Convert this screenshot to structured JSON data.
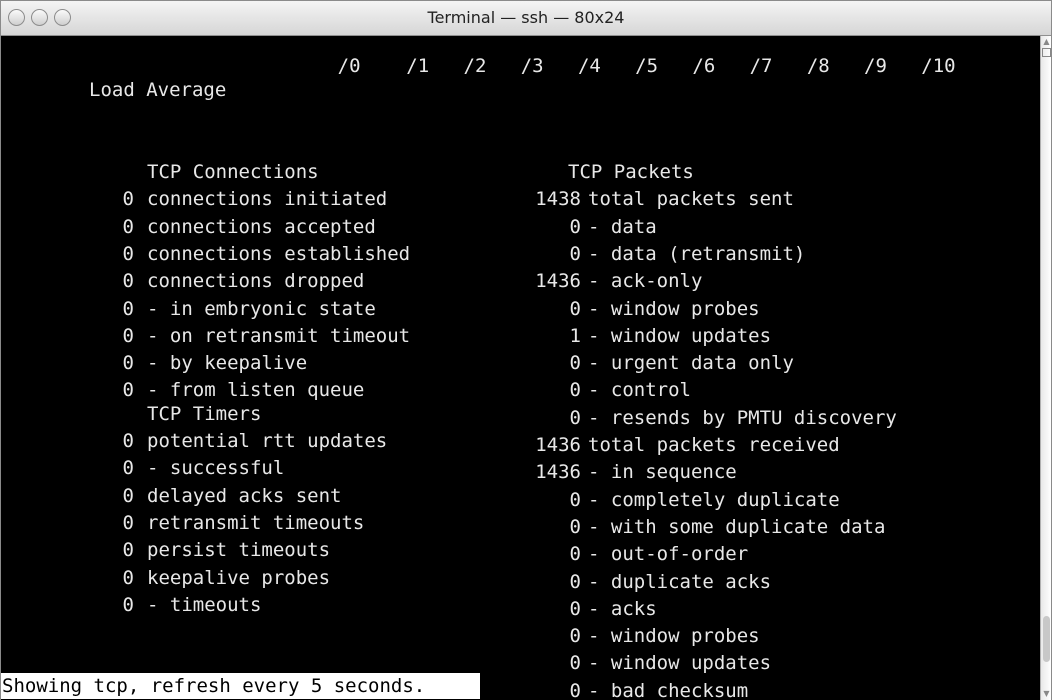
{
  "window": {
    "title": "Terminal — ssh — 80x24"
  },
  "load_average": {
    "label": "Load Average",
    "scale": [
      "/0",
      "/1",
      "/2",
      "/3",
      "/4",
      "/5",
      "/6",
      "/7",
      "/8",
      "/9",
      "/10"
    ]
  },
  "tcp_connections": {
    "heading": "TCP Connections",
    "rows": [
      {
        "value": "0",
        "label": "connections initiated"
      },
      {
        "value": "0",
        "label": "connections accepted"
      },
      {
        "value": "0",
        "label": "connections established"
      },
      {
        "value": "0",
        "label": "connections dropped"
      },
      {
        "value": "0",
        "label": "- in embryonic state"
      },
      {
        "value": "0",
        "label": "- on retransmit timeout"
      },
      {
        "value": "0",
        "label": "- by keepalive"
      },
      {
        "value": "0",
        "label": "- from listen queue"
      }
    ]
  },
  "tcp_timers": {
    "heading": "TCP Timers",
    "rows": [
      {
        "value": "0",
        "label": "potential rtt updates"
      },
      {
        "value": "0",
        "label": "- successful"
      },
      {
        "value": "0",
        "label": "delayed acks sent"
      },
      {
        "value": "0",
        "label": "retransmit timeouts"
      },
      {
        "value": "0",
        "label": "persist timeouts"
      },
      {
        "value": "0",
        "label": "keepalive probes"
      },
      {
        "value": "0",
        "label": "- timeouts"
      }
    ]
  },
  "tcp_packets": {
    "heading": "TCP Packets",
    "rows": [
      {
        "value": "1438",
        "label": "total packets sent"
      },
      {
        "value": "0",
        "label": "- data"
      },
      {
        "value": "0",
        "label": "- data (retransmit)"
      },
      {
        "value": "1436",
        "label": "- ack-only"
      },
      {
        "value": "0",
        "label": "- window probes"
      },
      {
        "value": "1",
        "label": "- window updates"
      },
      {
        "value": "0",
        "label": "- urgent data only"
      },
      {
        "value": "0",
        "label": "- control"
      },
      {
        "value": "0",
        "label": "- resends by PMTU discovery"
      },
      {
        "value": "1436",
        "label": "total packets received"
      },
      {
        "value": "1436",
        "label": "- in sequence"
      },
      {
        "value": "0",
        "label": "- completely duplicate"
      },
      {
        "value": "0",
        "label": "- with some duplicate data"
      },
      {
        "value": "0",
        "label": "- out-of-order"
      },
      {
        "value": "0",
        "label": "- duplicate acks"
      },
      {
        "value": "0",
        "label": "- acks"
      },
      {
        "value": "0",
        "label": "- window probes"
      },
      {
        "value": "0",
        "label": "- window updates"
      },
      {
        "value": "0",
        "label": "- bad checksum"
      }
    ]
  },
  "status": {
    "text": "Showing tcp, refresh every 5 seconds."
  }
}
